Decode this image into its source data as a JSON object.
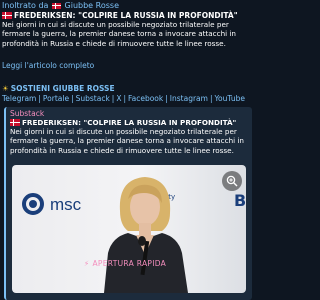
{
  "forward": {
    "prefix": "Inoltrato da",
    "source": "Giubbe Rosse"
  },
  "message": {
    "title": "FREDERIKSEN: \"COLPIRE LA RUSSIA IN PROFONDITÀ\"",
    "lines": [
      "Nei giorni in cui si discute un possibile negoziato trilaterale per",
      "fermare la guerra, la premier danese torna a invocare attacchi in",
      "profondità in Russia e chiede di rimuovere tutte le linee rosse."
    ],
    "read_more": "Leggi l'articolo completo"
  },
  "channel": {
    "name": "SOSTIENI GIUBBE ROSSE",
    "links": [
      "Telegram",
      "Portale",
      "Substack",
      "X",
      "Facebook",
      "Instagram",
      "YouTube"
    ]
  },
  "preview": {
    "site": "Substack",
    "title": "FREDERIKSEN: \"COLPIRE LA RUSSIA IN PROFONDITÀ\"",
    "lines": [
      "Nei giorni in cui si discute un possibile negoziato trilaterale per",
      "fermare la guerra, la premier danese torna a invocare attacchi in",
      "profondità in Russia e chiede di rimuovere tutte le linee rosse."
    ],
    "image_text": {
      "logo": "msc",
      "urity": "urity",
      "corner": "B"
    }
  },
  "instant_view": {
    "label": "APERTURA RAPIDA"
  },
  "colors": {
    "background": "#0e1621",
    "link": "#7cc0f5",
    "accent_pink": "#f48ebd",
    "card": "#1c2b3c"
  }
}
